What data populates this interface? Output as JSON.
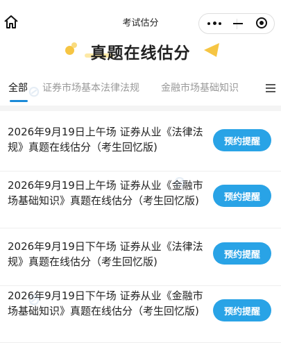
{
  "header": {
    "title": "考试估分",
    "home_icon": "home-icon",
    "capsule_icons": [
      "more-icon",
      "minimize-icon",
      "close-icon"
    ]
  },
  "banner": {
    "title": "真题在线估分"
  },
  "tabs": [
    {
      "label": "全部",
      "active": true
    },
    {
      "label": "证券市场基本法律法规",
      "active": false
    },
    {
      "label": "金融市场基础知识",
      "active": false
    }
  ],
  "tabs_menu_icon": "menu-icon",
  "items": [
    {
      "title": "2026年9月19日上午场 证券从业《法律法规》真题在线估分（考生回忆版)",
      "button": "预约提醒"
    },
    {
      "title": "2026年9月19日上午场 证券从业《金融市场基础知识》真题在线估分（考生回忆版)",
      "button": "预约提醒"
    },
    {
      "title": "2026年9月19日下午场 证券从业《法律法规》真题在线估分（考生回忆版)",
      "button": "预约提醒"
    },
    {
      "title": "2026年9月19日下午场 证券从业《金融市场基础知识》真题在线估分（考生回忆版)",
      "button": "预约提醒"
    }
  ],
  "colors": {
    "accent": "#29a3e6",
    "tab_underline": "#1b8ad8",
    "banner_dot": "#f6c543"
  }
}
